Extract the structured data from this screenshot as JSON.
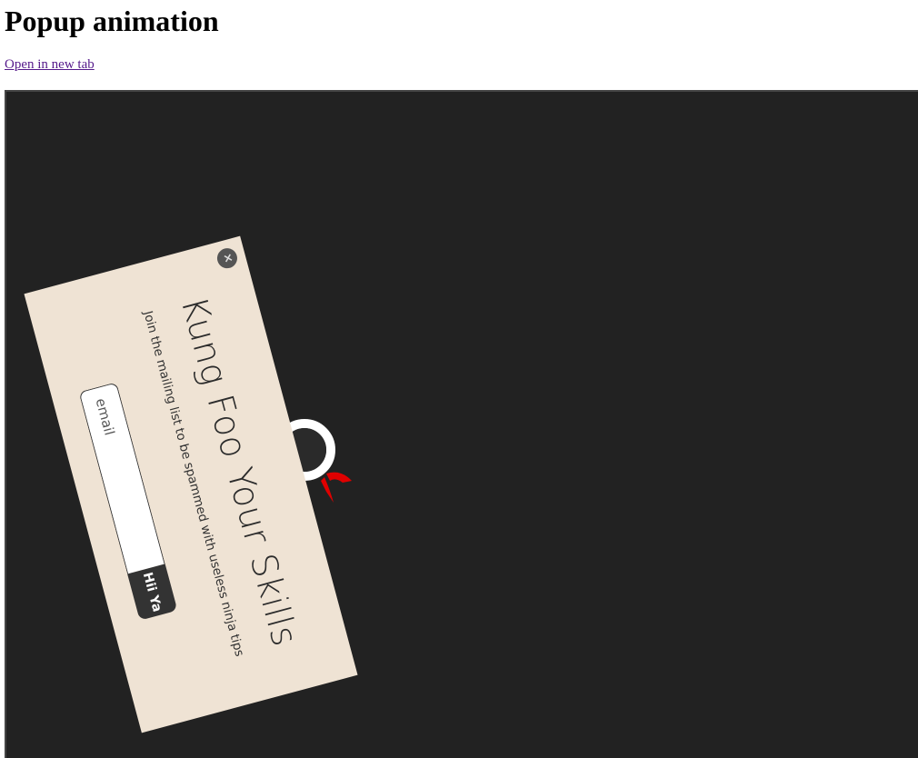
{
  "page": {
    "title": "Popup animation",
    "open_link": "Open in new tab"
  },
  "popup": {
    "close_label": "×",
    "title": "Kung Foo Your Skills",
    "subtitle": "Join the mailing list to be spammed with useless ninja tips",
    "email_placeholder": "email",
    "email_value": "",
    "submit_label": "Hii Ya"
  },
  "colors": {
    "frame_background": "#222222",
    "card_background": "#efe3d4",
    "button_background": "#333333",
    "ninja_ribbon": "#e00000"
  },
  "icons": {
    "close": "close-icon",
    "mascot": "ninja-icon"
  }
}
